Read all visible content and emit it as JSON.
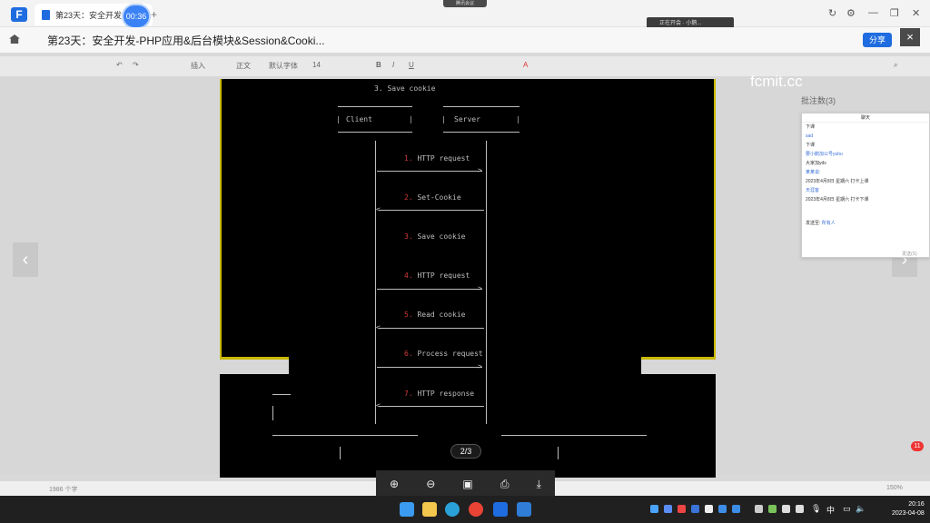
{
  "window": {
    "tab_title": "第23天：安全开发-PHP...",
    "timer": "00:36",
    "top_banner": "腾讯会议",
    "meeting_status": "正在开会 · 小鹅..."
  },
  "document": {
    "title": "第23天：安全开发-PHP应用&后台模块&Session&Cooki...",
    "share_label": "分享",
    "close_label": "×"
  },
  "toolbar": {
    "insert": "插入",
    "style": "正文",
    "font": "默认字体",
    "size": "14"
  },
  "diagram": {
    "title": "3. Save cookie",
    "client": "Client",
    "server": "Server",
    "steps": [
      {
        "num": "1.",
        "text": "HTTP request",
        "direction": "right"
      },
      {
        "num": "2.",
        "text": "Set-Cookie",
        "direction": "left"
      },
      {
        "num": "3.",
        "text": "Save cookie",
        "direction": "none"
      },
      {
        "num": "4.",
        "text": "HTTP request",
        "direction": "right"
      },
      {
        "num": "5.",
        "text": "Read cookie",
        "direction": "left"
      },
      {
        "num": "6.",
        "text": "Process request",
        "direction": "right"
      },
      {
        "num": "7.",
        "text": "HTTP response",
        "direction": "left"
      }
    ]
  },
  "watermark": "fcmit.cc",
  "comments_label": "批注数(3)",
  "page_indicator": "2/3",
  "notification_count": "11",
  "chat": {
    "title": "聊天",
    "lines": [
      {
        "text": "下课",
        "color": "#333333"
      },
      {
        "text": "sad",
        "color": "#3a6fd8"
      },
      {
        "text": "下课",
        "color": "#333333"
      },
      {
        "text": "要小鹅加公号yuhu",
        "color": "#3a6fd8"
      },
      {
        "text": "大家加yds",
        "color": "#333333"
      },
      {
        "text": "某某说:",
        "color": "#3a6fd8"
      },
      {
        "text": "2023年4月8日 星期六 打卡上课",
        "color": "#333333"
      },
      {
        "text": "天涯客",
        "color": "#3a6fd8"
      },
      {
        "text": "2023年4月8日 星期六 打卡下课",
        "color": "#333333"
      }
    ],
    "send_to": "发送至:",
    "recipient": "所有人",
    "send_button": "发送(S)"
  },
  "status": {
    "word_count": "1986 个字",
    "zoom": "150%"
  },
  "clock": {
    "time": "20:16",
    "date": "2023-04-08"
  },
  "tray": {
    "ime": "中"
  }
}
